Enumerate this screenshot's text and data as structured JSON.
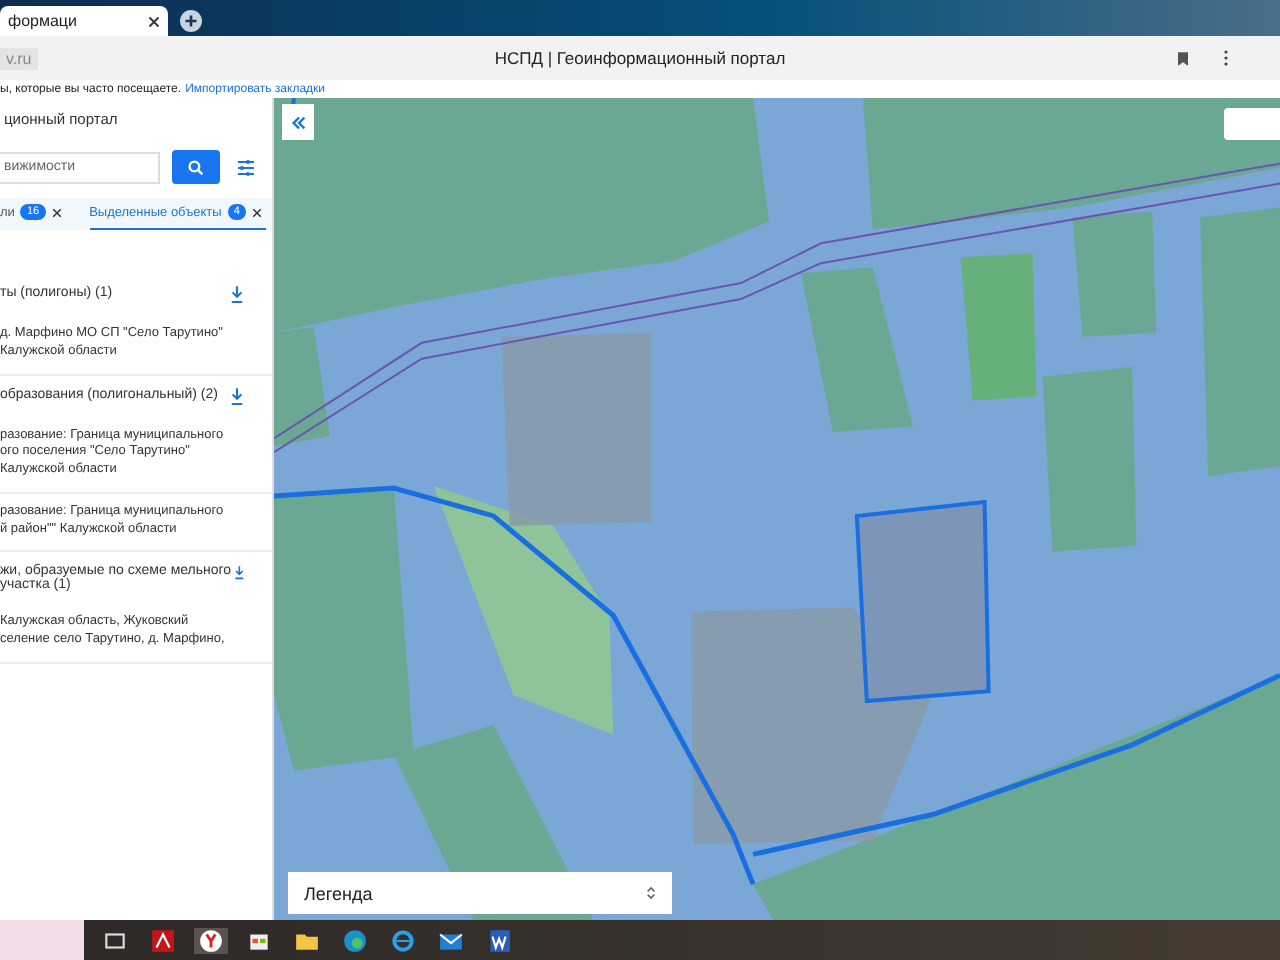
{
  "browser": {
    "tab": {
      "title": "формаци"
    },
    "address": "v.ru",
    "page_title": "НСПД | Геоинформационный портал",
    "bookmarks_hint": "ы, которые вы часто посещаете.",
    "bookmarks_link": "Импортировать закладки"
  },
  "panel": {
    "title": "ционный портал",
    "search": {
      "placeholder": "вижимости"
    },
    "tabs": [
      {
        "label": "ли",
        "count": "16",
        "selected": false
      },
      {
        "label": "Выделенные объекты",
        "count": "4",
        "selected": true
      }
    ],
    "sections": [
      {
        "title": "ты (полигоны) (1)",
        "items": [
          {
            "lines": [
              "д. Марфино МО СП \"Село Тарутино\"",
              "Калужской области"
            ]
          }
        ]
      },
      {
        "title": "образования (полигональный) (2)",
        "items": [
          {
            "lines": [
              "разование: Граница муниципального",
              "ого поселения \"Село Тарутино\"",
              "Калужской области"
            ]
          },
          {
            "lines": [
              "разование: Граница муниципального",
              "й район\"\" Калужской области"
            ]
          }
        ]
      },
      {
        "title": "жи, образуемые по схеме мельного участка (1)",
        "items": [
          {
            "lines": [
              " Калужская область, Жуковский",
              "селение село Тарутино, д. Марфино,"
            ]
          }
        ]
      }
    ]
  },
  "map": {
    "legend": "Легенда"
  }
}
